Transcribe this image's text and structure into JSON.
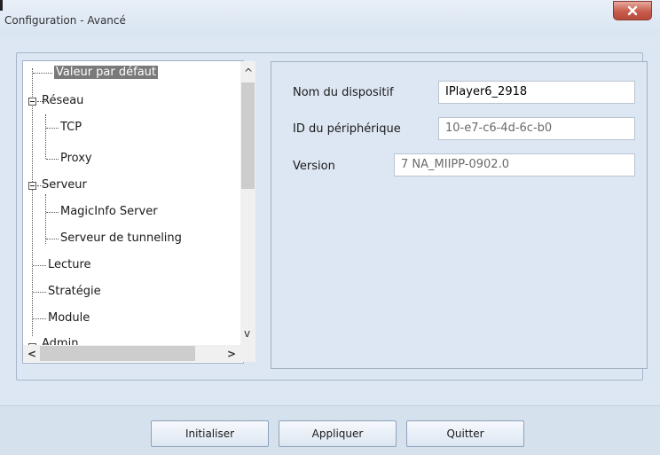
{
  "window": {
    "title": "Configuration - Avancé",
    "close_symbol": "x"
  },
  "tree": {
    "items": [
      {
        "label": "Valeur par défaut",
        "selected": true
      },
      {
        "label": "Réseau",
        "expanded": true
      },
      {
        "label": "TCP"
      },
      {
        "label": "Proxy"
      },
      {
        "label": "Serveur",
        "expanded": true
      },
      {
        "label": "MagicInfo Server"
      },
      {
        "label": "Serveur de tunneling"
      },
      {
        "label": "Lecture"
      },
      {
        "label": "Stratégie"
      },
      {
        "label": "Module"
      },
      {
        "label": "Admin"
      }
    ],
    "scroll_up": "^",
    "scroll_down": "v",
    "scroll_left": "<",
    "scroll_right": ">"
  },
  "settings": {
    "device_name": {
      "label": "Nom du dispositif",
      "value": "IPlayer6_2918"
    },
    "device_id": {
      "label": "ID du périphérique",
      "value": "10-e7-c6-4d-6c-b0"
    },
    "version": {
      "label": "Version",
      "value": "7 NA_MIIPP-0902.0"
    }
  },
  "buttons": {
    "initialize": "Initialiser",
    "apply": "Appliquer",
    "quit": "Quitter"
  },
  "colors": {
    "background": "#dde7f3",
    "footer": "#d6e1ee",
    "close": "#c75c4c",
    "selection": "#7a7a7a"
  }
}
